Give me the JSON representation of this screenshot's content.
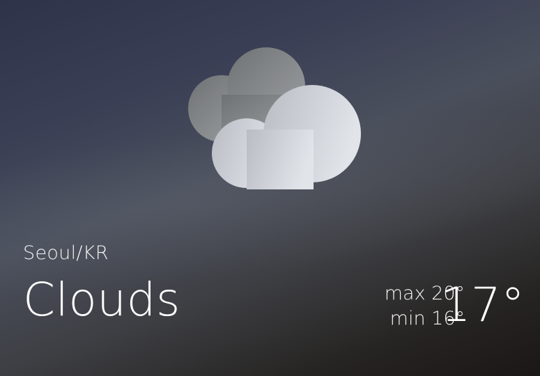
{
  "location": "Seoul/KR",
  "condition": "Clouds",
  "temperature": {
    "max": "max 20°",
    "min": "min 16°",
    "current": "17°"
  },
  "icon": "clouds-icon",
  "colors": {
    "background_top": "#2f3349",
    "background_bottom": "#1a1716",
    "cloud_front": "#d9dde4",
    "cloud_back": "#8a8d90",
    "text": "#ffffff"
  }
}
